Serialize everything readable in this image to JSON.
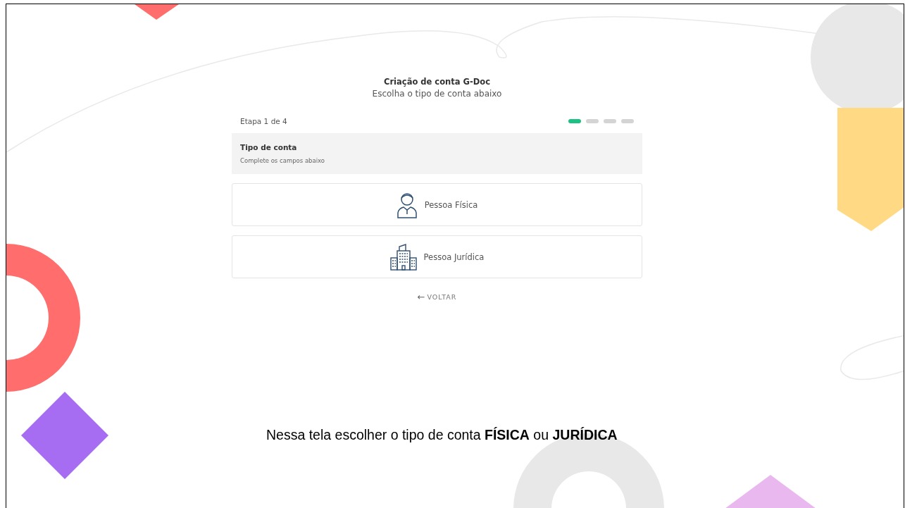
{
  "header": {
    "title": "Criação de conta G-Doc",
    "subtitle": "Escolha o tipo de conta abaixo"
  },
  "progress": {
    "label": "Etapa 1 de 4",
    "steps": [
      {
        "selected": true
      },
      {
        "selected": false
      },
      {
        "selected": false
      },
      {
        "selected": false
      }
    ]
  },
  "section": {
    "title": "Tipo de conta",
    "hint": "Complete os campos abaixo"
  },
  "options": [
    {
      "kind": "person",
      "label": "Pessoa Física"
    },
    {
      "kind": "company",
      "label": "Pessoa Jurídica"
    }
  ],
  "back_link": {
    "icon": "←",
    "label": "VOLTAR"
  },
  "caption": "Nessa tela escolher o tipo de conta  **FÍSICA** ou **JURÍDICA**"
}
